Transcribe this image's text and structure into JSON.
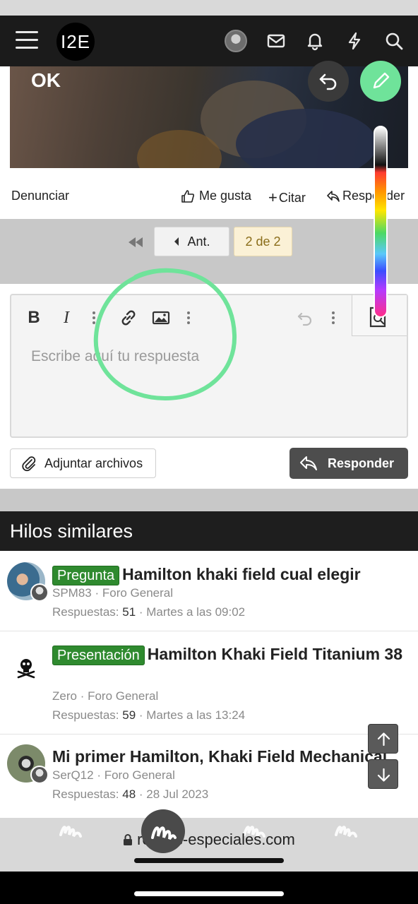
{
  "topbar": {
    "logo_text": "I2E",
    "icons": [
      "menu-icon",
      "avatar",
      "mail-icon",
      "bell-icon",
      "bolt-icon",
      "search-icon"
    ]
  },
  "post": {
    "image_overlay_text": "OK",
    "actions": {
      "report": "Denunciar",
      "like": "Me gusta",
      "quote": "Citar",
      "reply": "Responder"
    }
  },
  "pagination": {
    "prev_label": "Ant.",
    "current": "2 de 2"
  },
  "editor": {
    "placeholder": "Escribe aquí tu respuesta",
    "toolbar": [
      "bold-icon",
      "italic-icon",
      "more-icon",
      "link-icon",
      "image-icon",
      "more-icon",
      "undo-icon",
      "more-icon",
      "preview-icon"
    ],
    "bold_label": "B",
    "italic_label": "I"
  },
  "buttons": {
    "attach": "Adjuntar archivos",
    "reply": "Responder"
  },
  "similar": {
    "header": "Hilos similares",
    "threads": [
      {
        "tag": "Pregunta",
        "title": "Hamilton khaki field cual elegir",
        "author": "SPM83",
        "forum": "Foro General",
        "replies_label": "Respuestas:",
        "replies": "51",
        "date": "Martes a las 09:02"
      },
      {
        "tag": "Presentación",
        "title": "Hamilton Khaki Field Titanium 38",
        "author": "Zero",
        "forum": "Foro General",
        "replies_label": "Respuestas:",
        "replies": "59",
        "date": "Martes a las 13:24"
      },
      {
        "tag": "",
        "title": "Mi primer Hamilton, Khaki Field Mechanical",
        "author": "SerQ12",
        "forum": "Foro General",
        "replies_label": "Respuestas:",
        "replies": "48",
        "date": "28 Jul 2023"
      }
    ]
  },
  "browser": {
    "url": "relojes-especiales.com"
  },
  "colors": {
    "annotation_green": "#6fe39a",
    "tag_green": "#2f8a2f",
    "topbar": "#1b1b1b"
  }
}
